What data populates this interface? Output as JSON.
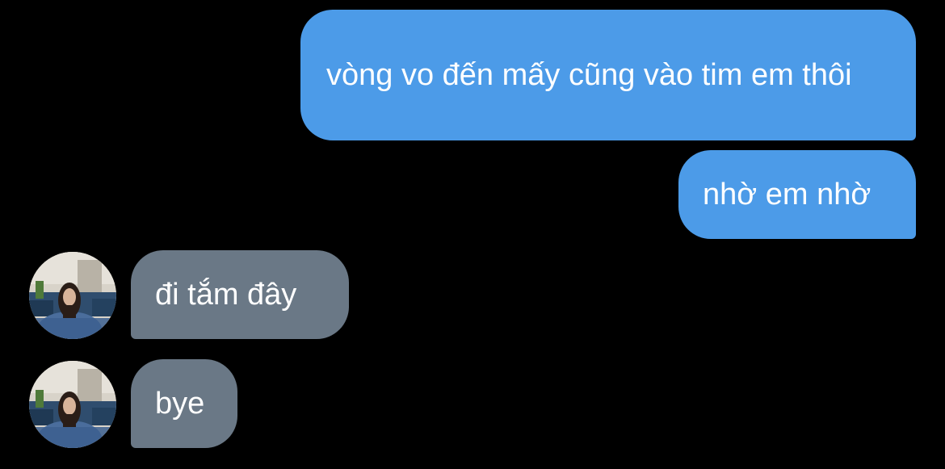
{
  "conversation": {
    "messages": [
      {
        "direction": "sent",
        "text": "vòng vo đến mấy cũng vào tim em thôi"
      },
      {
        "direction": "sent",
        "text": "nhờ em nhờ"
      },
      {
        "direction": "received",
        "text": "đi tắm đây"
      },
      {
        "direction": "received",
        "text": "bye"
      }
    ]
  },
  "colors": {
    "background": "#000000",
    "sent_bubble": "#4c9be8",
    "received_bubble": "#6a7886",
    "text": "#ffffff"
  },
  "icons": {
    "contact_avatar": "contact-avatar-photo"
  }
}
